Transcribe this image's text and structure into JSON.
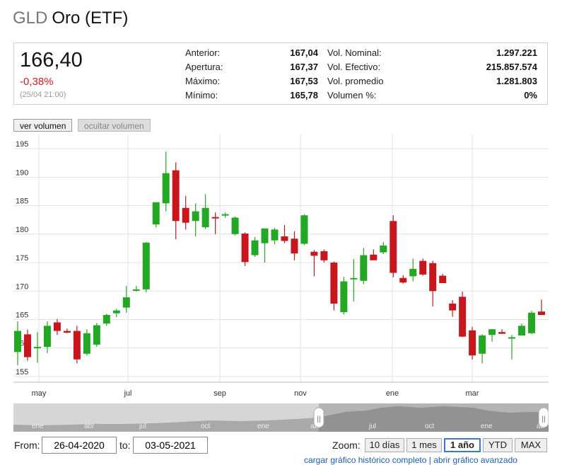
{
  "header": {
    "ticker": "GLD",
    "name": "Oro (ETF)"
  },
  "quote": {
    "price": "166,40",
    "change": "-0,38%",
    "time": "(25/04 21:00)",
    "stats_left": [
      {
        "label": "Anterior:",
        "value": "167,04"
      },
      {
        "label": "Apertura:",
        "value": "167,37"
      },
      {
        "label": "Máximo:",
        "value": "167,53"
      },
      {
        "label": "Mínimo:",
        "value": "165,78"
      }
    ],
    "stats_right": [
      {
        "label": "Vol. Nominal:",
        "value": "1.297.221"
      },
      {
        "label": "Vol. Efectivo:",
        "value": "215.857.574"
      },
      {
        "label": "Vol. promedio",
        "value": "1.281.803"
      },
      {
        "label": "Volumen %:",
        "value": "0%"
      }
    ]
  },
  "volume_buttons": {
    "show": "ver volumen",
    "hide": "ocultar volumen"
  },
  "colors": {
    "up": "#22a822",
    "down": "#c8161d",
    "grid": "#e2e2e2",
    "navigator_fill": "#a9a9a9"
  },
  "chart_data": {
    "type": "candlestick",
    "y_ticks": [
      "155",
      "160",
      "165",
      "170",
      "175",
      "180",
      "185",
      "190",
      "195"
    ],
    "ylim": [
      154,
      197
    ],
    "x_ticks": [
      "may",
      "jul",
      "sep",
      "nov",
      "ene",
      "mar"
    ],
    "candles": [
      {
        "o": 159.3,
        "h": 164.7,
        "l": 157.0,
        "c": 163.0
      },
      {
        "o": 162.4,
        "h": 163.2,
        "l": 157.8,
        "c": 158.4
      },
      {
        "o": 160.1,
        "h": 162.8,
        "l": 157.4,
        "c": 160.2
      },
      {
        "o": 160.2,
        "h": 164.7,
        "l": 159.1,
        "c": 163.9
      },
      {
        "o": 164.5,
        "h": 165.1,
        "l": 162.3,
        "c": 163.0
      },
      {
        "o": 163.0,
        "h": 163.4,
        "l": 162.6,
        "c": 162.7
      },
      {
        "o": 163.0,
        "h": 163.9,
        "l": 157.3,
        "c": 158.0
      },
      {
        "o": 159.0,
        "h": 163.3,
        "l": 158.7,
        "c": 162.6
      },
      {
        "o": 160.6,
        "h": 164.4,
        "l": 160.2,
        "c": 164.0
      },
      {
        "o": 164.3,
        "h": 166.0,
        "l": 163.9,
        "c": 165.8
      },
      {
        "o": 166.1,
        "h": 166.9,
        "l": 165.4,
        "c": 166.6
      },
      {
        "o": 167.1,
        "h": 170.9,
        "l": 166.2,
        "c": 168.9
      },
      {
        "o": 170.1,
        "h": 170.9,
        "l": 169.9,
        "c": 170.3
      },
      {
        "o": 170.3,
        "h": 178.6,
        "l": 169.8,
        "c": 178.5
      },
      {
        "o": 181.7,
        "h": 185.2,
        "l": 181.2,
        "c": 185.6
      },
      {
        "o": 185.4,
        "h": 194.5,
        "l": 184.0,
        "c": 190.7
      },
      {
        "o": 191.2,
        "h": 192.6,
        "l": 179.1,
        "c": 182.3
      },
      {
        "o": 184.6,
        "h": 186.7,
        "l": 180.8,
        "c": 182.0
      },
      {
        "o": 182.3,
        "h": 185.4,
        "l": 179.6,
        "c": 184.0
      },
      {
        "o": 181.2,
        "h": 187.0,
        "l": 180.9,
        "c": 184.6
      },
      {
        "o": 183.0,
        "h": 183.8,
        "l": 180.0,
        "c": 182.9
      },
      {
        "o": 183.3,
        "h": 183.8,
        "l": 182.9,
        "c": 183.5
      },
      {
        "o": 180.0,
        "h": 183.1,
        "l": 179.8,
        "c": 182.9
      },
      {
        "o": 180.1,
        "h": 180.3,
        "l": 174.4,
        "c": 175.1
      },
      {
        "o": 176.3,
        "h": 179.5,
        "l": 176.0,
        "c": 178.9
      },
      {
        "o": 178.4,
        "h": 180.3,
        "l": 175.0,
        "c": 181.0
      },
      {
        "o": 178.9,
        "h": 181.1,
        "l": 178.2,
        "c": 180.8
      },
      {
        "o": 179.6,
        "h": 181.6,
        "l": 178.4,
        "c": 178.8
      },
      {
        "o": 179.2,
        "h": 180.5,
        "l": 175.4,
        "c": 176.6
      },
      {
        "o": 178.3,
        "h": 183.5,
        "l": 178.1,
        "c": 183.3
      },
      {
        "o": 176.9,
        "h": 177.2,
        "l": 172.6,
        "c": 176.2
      },
      {
        "o": 177.0,
        "h": 177.3,
        "l": 175.0,
        "c": 175.4
      },
      {
        "o": 175.0,
        "h": 175.2,
        "l": 166.6,
        "c": 167.8
      },
      {
        "o": 166.3,
        "h": 172.5,
        "l": 165.9,
        "c": 171.7
      },
      {
        "o": 172.1,
        "h": 175.6,
        "l": 168.2,
        "c": 172.3
      },
      {
        "o": 171.8,
        "h": 177.6,
        "l": 171.2,
        "c": 176.3
      },
      {
        "o": 176.4,
        "h": 177.3,
        "l": 175.5,
        "c": 175.4
      },
      {
        "o": 176.8,
        "h": 178.6,
        "l": 176.5,
        "c": 178.0
      },
      {
        "o": 182.3,
        "h": 183.3,
        "l": 172.4,
        "c": 173.2
      },
      {
        "o": 172.3,
        "h": 172.8,
        "l": 171.3,
        "c": 171.5
      },
      {
        "o": 172.6,
        "h": 175.7,
        "l": 171.7,
        "c": 173.9
      },
      {
        "o": 175.3,
        "h": 175.7,
        "l": 172.7,
        "c": 172.9
      },
      {
        "o": 174.9,
        "h": 175.3,
        "l": 167.3,
        "c": 170.0
      },
      {
        "o": 172.7,
        "h": 173.0,
        "l": 171.4,
        "c": 171.4
      },
      {
        "o": 167.8,
        "h": 168.4,
        "l": 165.5,
        "c": 166.6
      },
      {
        "o": 169.0,
        "h": 169.9,
        "l": 161.9,
        "c": 162.0
      },
      {
        "o": 163.1,
        "h": 163.7,
        "l": 158.0,
        "c": 158.7
      },
      {
        "o": 159.0,
        "h": 162.4,
        "l": 157.3,
        "c": 162.2
      },
      {
        "o": 162.3,
        "h": 163.3,
        "l": 161.1,
        "c": 163.3
      },
      {
        "o": 162.8,
        "h": 163.3,
        "l": 162.5,
        "c": 162.5
      },
      {
        "o": 161.7,
        "h": 162.3,
        "l": 158.0,
        "c": 161.9
      },
      {
        "o": 162.2,
        "h": 164.3,
        "l": 162.3,
        "c": 163.9
      },
      {
        "o": 162.6,
        "h": 166.5,
        "l": 162.4,
        "c": 166.2
      },
      {
        "o": 166.4,
        "h": 168.5,
        "l": 166.1,
        "c": 165.8
      }
    ]
  },
  "navigator": {
    "labels": [
      "ene",
      "abr",
      "jul",
      "oct",
      "ene",
      "abr",
      "jul",
      "oct",
      "ene",
      "ab"
    ],
    "handle_glyph": "||"
  },
  "range": {
    "from_label": "From:",
    "from_value": "26-04-2020",
    "to_label": "to:",
    "to_value": "03-05-2021"
  },
  "zoom": {
    "label": "Zoom:",
    "buttons": [
      {
        "label": "10 días",
        "active": false
      },
      {
        "label": "1 mes",
        "active": false
      },
      {
        "label": "1 año",
        "active": true
      },
      {
        "label": "YTD",
        "active": false
      },
      {
        "label": "MAX",
        "active": false
      }
    ]
  },
  "links": {
    "text": "cargar gráfico histórico completo | abrir gráfico avanzado"
  }
}
